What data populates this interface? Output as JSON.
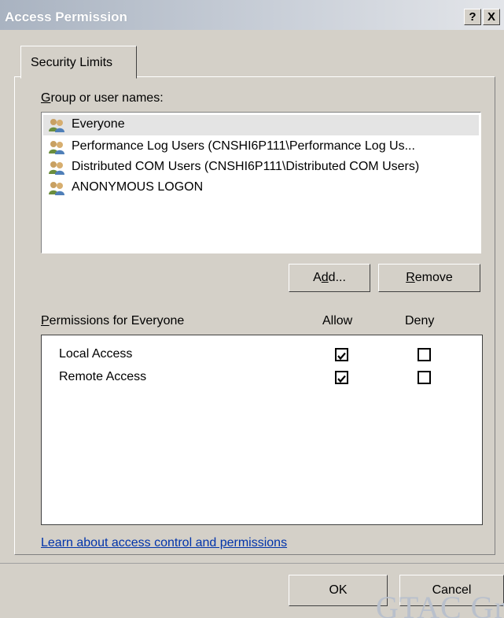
{
  "window": {
    "title": "Access Permission",
    "help_button": "?",
    "close_button": "X"
  },
  "tabs": [
    {
      "label": "Security Limits"
    }
  ],
  "groups": {
    "label_prefix": "G",
    "label_rest": "roup or user names:",
    "items": [
      {
        "name": "Everyone",
        "icon": "users-icon",
        "selected": true
      },
      {
        "name": "Performance Log Users (CNSHI6P111\\Performance Log Us...",
        "icon": "users-icon"
      },
      {
        "name": "Distributed COM Users (CNSHI6P111\\Distributed COM Users)",
        "icon": "users-icon"
      },
      {
        "name": "ANONYMOUS LOGON",
        "icon": "users-icon"
      }
    ],
    "add_button_pre": "A",
    "add_button_u": "d",
    "add_button_post": "d...",
    "remove_button_u": "R",
    "remove_button_post": "emove"
  },
  "permissions": {
    "label_u": "P",
    "label_rest": "ermissions for Everyone",
    "allow_header": "Allow",
    "deny_header": "Deny",
    "rows": [
      {
        "name": "Local Access",
        "allow": true,
        "deny": false
      },
      {
        "name": "Remote Access",
        "allow": true,
        "deny": false
      }
    ]
  },
  "help_link": "Learn about access control and permissions",
  "footer": {
    "ok_button": "OK",
    "cancel_button": "Cancel"
  },
  "watermark": "GTAC Gre",
  "colors": {
    "dialog_bg": "#d4d0c8",
    "titlebar_text": "#ffffff",
    "link": "#0033aa",
    "selection": "#e4e4e4"
  }
}
